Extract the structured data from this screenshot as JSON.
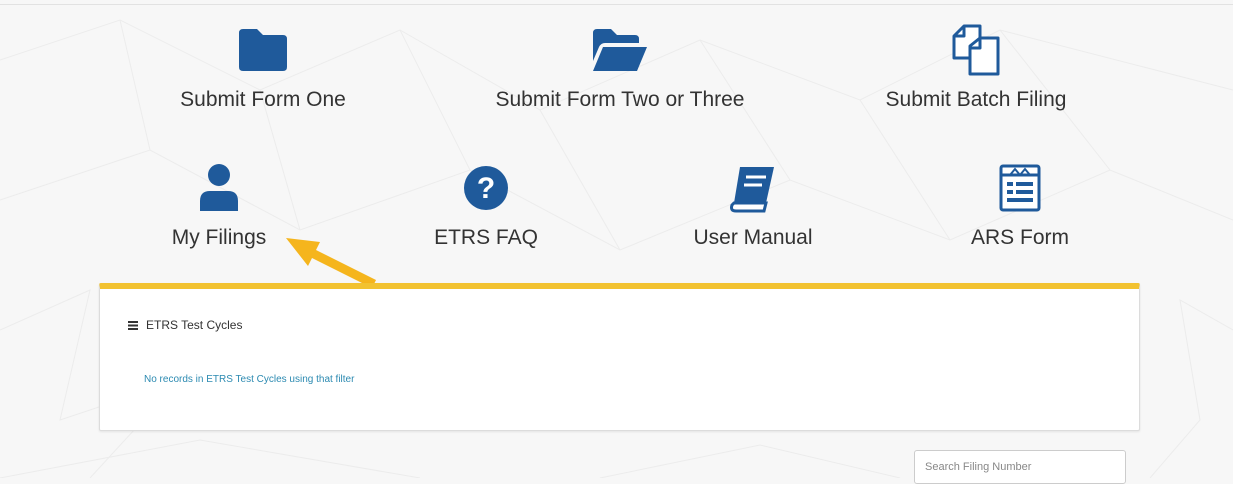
{
  "colors": {
    "icon_blue": "#1f5a9b",
    "accent_yellow": "#f2c230",
    "link_blue": "#2c8ab1",
    "arrow": "#f5b51d"
  },
  "tiles": [
    {
      "label": "Submit Form One",
      "icon": "folder-icon"
    },
    {
      "label": "Submit Form Two or Three",
      "icon": "folder-open-icon"
    },
    {
      "label": "Submit Batch Filing",
      "icon": "copy-files-icon"
    },
    {
      "label": "My Filings",
      "icon": "user-icon"
    },
    {
      "label": "ETRS FAQ",
      "icon": "question-circle-icon"
    },
    {
      "label": "User Manual",
      "icon": "book-icon"
    },
    {
      "label": "ARS Form",
      "icon": "form-icon"
    }
  ],
  "panel": {
    "title": "ETRS Test Cycles",
    "icon": "list-icon",
    "empty_message": "No records in ETRS Test Cycles using that filter"
  },
  "search": {
    "placeholder": "Search Filing Number"
  }
}
